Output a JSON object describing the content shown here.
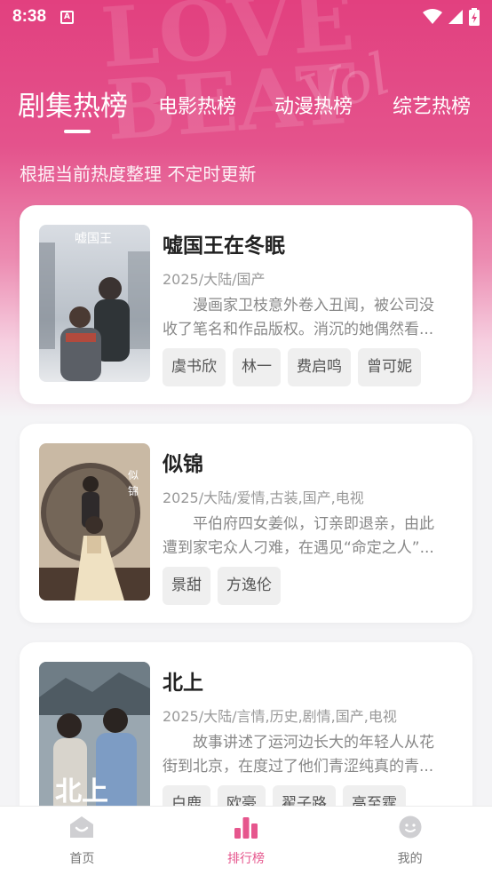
{
  "status_bar": {
    "time": "8:38"
  },
  "tabs": [
    {
      "label": "剧集热榜",
      "active": true
    },
    {
      "label": "电影热榜",
      "active": false
    },
    {
      "label": "动漫热榜",
      "active": false
    },
    {
      "label": "综艺热榜",
      "active": false
    }
  ],
  "subtitle": "根据当前热度整理 不定时更新",
  "shows": [
    {
      "title": "嘘国王在冬眠",
      "meta": "2025/大陆/国产",
      "description": "漫画家卫枝意外卷入丑闻，被公司没收了笔名和作品版权。消沉的她偶然看...",
      "cast": [
        "虞书欣",
        "林一",
        "费启鸣",
        "曾可妮"
      ]
    },
    {
      "title": "似锦",
      "meta": "2025/大陆/爱情,古装,国产,电视",
      "description": "平伯府四女姜似，订亲即退亲，由此遭到家宅众人刁难，在遇见“命定之人”...",
      "cast": [
        "景甜",
        "方逸伦"
      ]
    },
    {
      "title": "北上",
      "meta": "2025/大陆/言情,历史,剧情,国产,电视",
      "description": "故事讲述了运河边长大的年轻人从花街到北京，在度过了他们青涩纯真的青...",
      "cast": [
        "白鹿",
        "欧豪",
        "翟子路",
        "高至霆"
      ]
    }
  ],
  "bottom_nav": [
    {
      "label": "首页",
      "icon": "home-icon",
      "active": false
    },
    {
      "label": "排行榜",
      "icon": "ranking-icon",
      "active": true
    },
    {
      "label": "我的",
      "icon": "profile-icon",
      "active": false
    }
  ],
  "colors": {
    "accent": "#e6568d",
    "hero_top": "#e2407f"
  }
}
